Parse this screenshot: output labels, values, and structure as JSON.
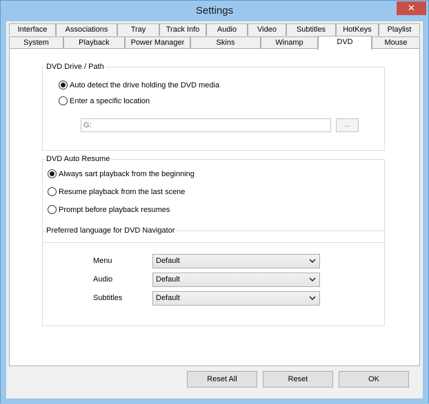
{
  "window": {
    "title": "Settings",
    "close_glyph": "✕"
  },
  "tabs_row1": [
    "Interface",
    "Associations",
    "Tray",
    "Track Info",
    "Audio",
    "Video",
    "Subtitles",
    "HotKeys",
    "Playlist"
  ],
  "tabs_row2": [
    "System",
    "Playback",
    "Power Manager",
    "Skins",
    "Winamp",
    "DVD",
    "Mouse"
  ],
  "active_tab": "DVD",
  "dvd_drive": {
    "legend": "DVD Drive / Path",
    "options": [
      {
        "label": "Auto detect the drive holding the DVD media",
        "selected": true
      },
      {
        "label": "Enter a specific location",
        "selected": false
      }
    ],
    "location_value": "G:",
    "browse_label": "..."
  },
  "auto_resume": {
    "legend": "DVD Auto Resume",
    "options": [
      {
        "label": "Always sart playback from the beginning",
        "selected": true
      },
      {
        "label": "Resume playback from the last scene",
        "selected": false
      },
      {
        "label": "Prompt before playback resumes",
        "selected": false
      }
    ]
  },
  "language": {
    "legend": "Preferred language for DVD Navigator",
    "rows": [
      {
        "label": "Menu",
        "value": "Default"
      },
      {
        "label": "Audio",
        "value": "Default"
      },
      {
        "label": "Subtitles",
        "value": "Default"
      }
    ]
  },
  "buttons": {
    "reset_all": "Reset All",
    "reset": "Reset",
    "ok": "OK"
  },
  "icons": {
    "close": "close-icon",
    "dropdown": "chevron-down-icon"
  }
}
